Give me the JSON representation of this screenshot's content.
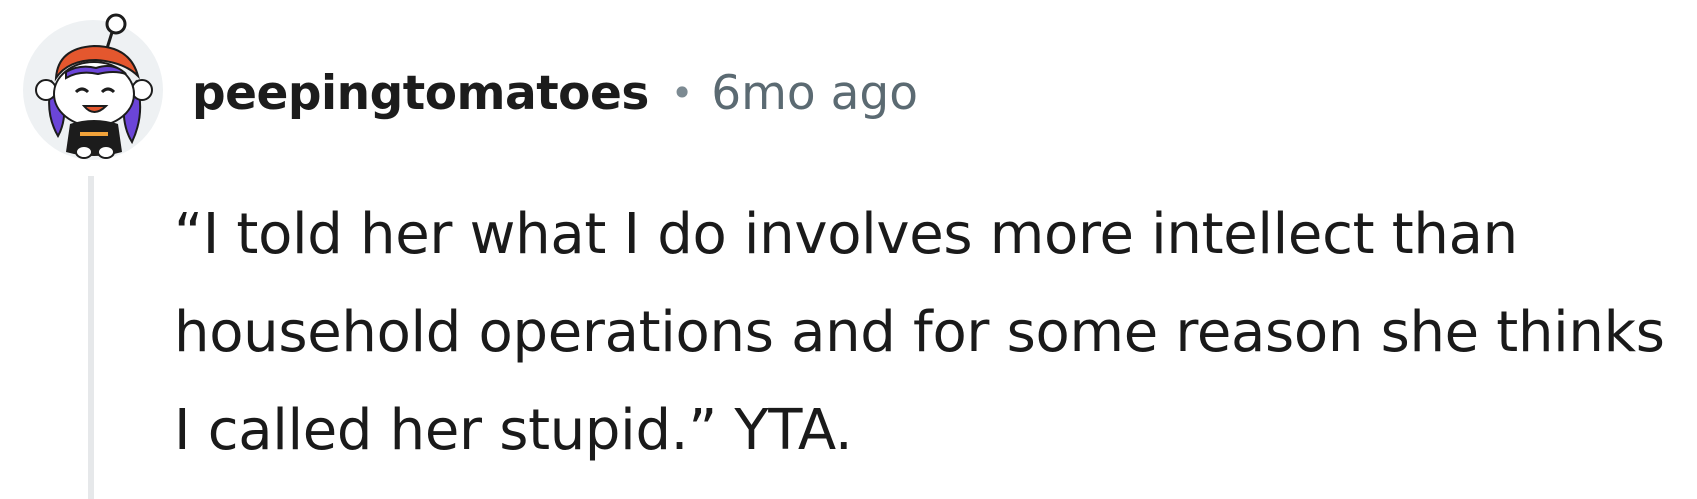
{
  "comment": {
    "username": "peepingtomatoes",
    "separator": "•",
    "timestamp": "6mo ago",
    "body": "“I told her what I do involves more intellect than household operations and for some reason she thinks I called her stupid.” YTA."
  }
}
